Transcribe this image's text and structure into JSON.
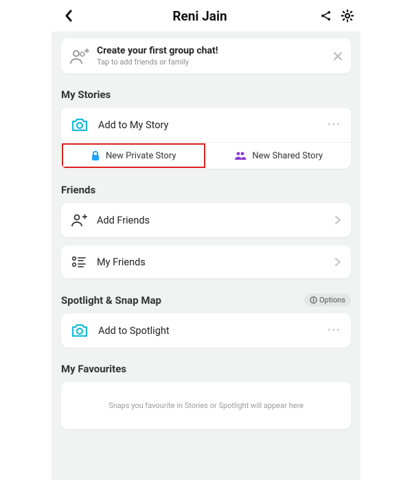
{
  "header": {
    "title": "Reni Jain"
  },
  "prompt": {
    "title": "Create your first group chat!",
    "subtitle": "Tap to add friends or family"
  },
  "sections": {
    "my_stories": {
      "title": "My Stories",
      "add_label": "Add to My Story",
      "new_private_label": "New Private Story",
      "new_shared_label": "New Shared Story"
    },
    "friends": {
      "title": "Friends",
      "add_friends_label": "Add Friends",
      "my_friends_label": "My Friends"
    },
    "spotlight": {
      "title": "Spotlight & Snap Map",
      "options_label": "Options",
      "add_spotlight_label": "Add to Spotlight"
    },
    "favourites": {
      "title": "My Favourites",
      "empty_text": "Snaps you favourite in Stories or Spotlight will appear here"
    }
  },
  "colors": {
    "cyan": "#17bcd8",
    "purple": "#8a3bcf",
    "lock_blue": "#1fa4ff"
  }
}
